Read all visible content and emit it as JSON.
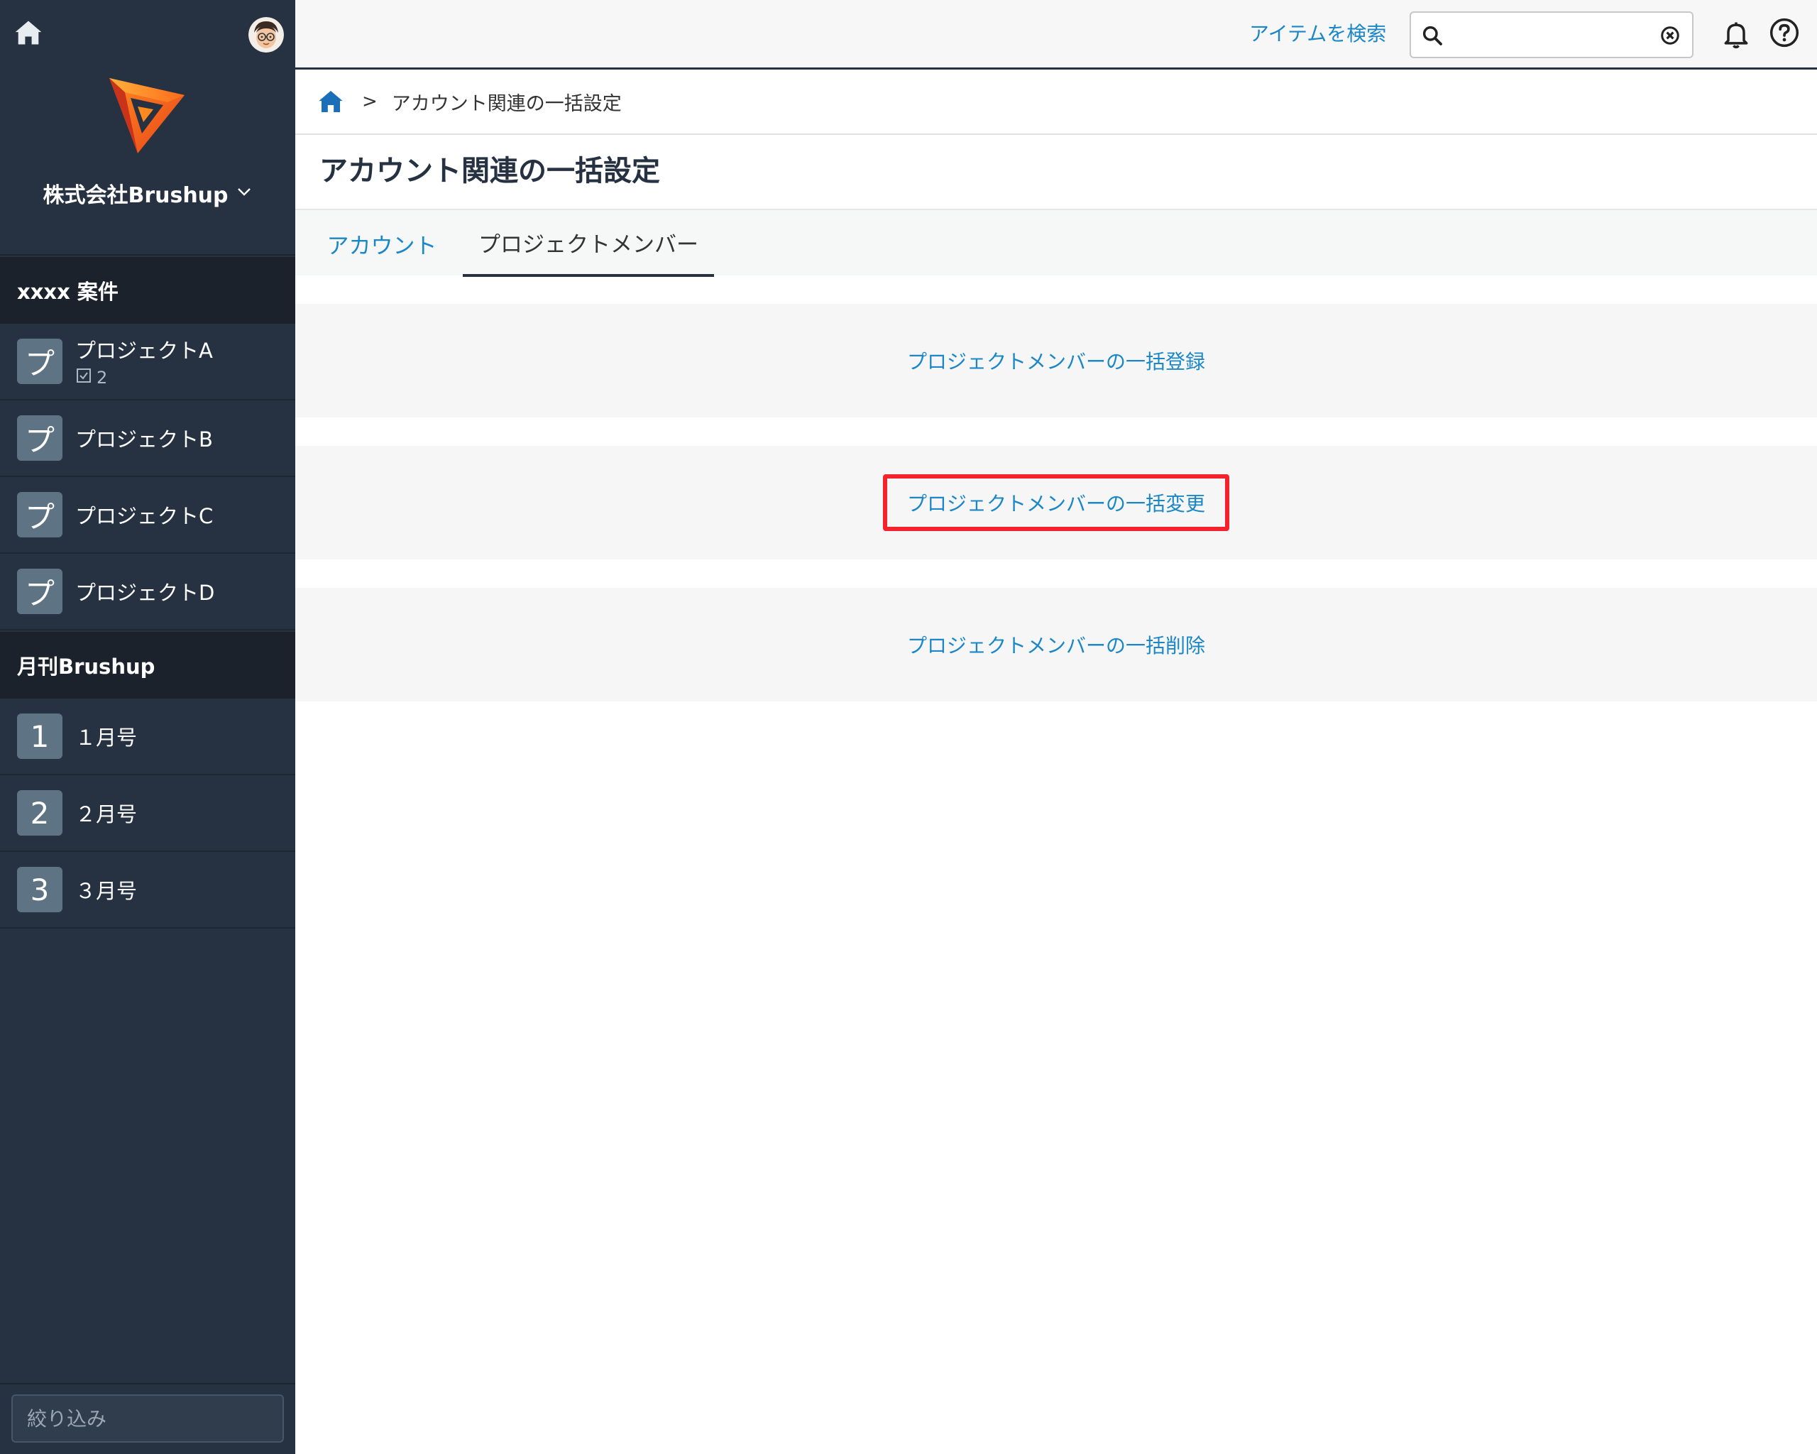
{
  "sidebar": {
    "org_name": "株式会社Brushup",
    "groups": [
      {
        "name": "xxxx 案件",
        "items": [
          {
            "badge": "プ",
            "label": "プロジェクトA",
            "count": "2"
          },
          {
            "badge": "プ",
            "label": "プロジェクトB"
          },
          {
            "badge": "プ",
            "label": "プロジェクトC"
          },
          {
            "badge": "プ",
            "label": "プロジェクトD"
          }
        ]
      },
      {
        "name": "月刊Brushup",
        "items": [
          {
            "badge": "1",
            "label": "１月号"
          },
          {
            "badge": "2",
            "label": "２月号"
          },
          {
            "badge": "3",
            "label": "３月号"
          }
        ]
      }
    ],
    "filter_placeholder": "絞り込み"
  },
  "topbar": {
    "search_link": "アイテムを検索",
    "search_value": ""
  },
  "breadcrumb": {
    "separator": ">",
    "current": "アカウント関連の一括設定"
  },
  "page": {
    "title": "アカウント関連の一括設定",
    "tabs": [
      {
        "label": "アカウント",
        "active": false
      },
      {
        "label": "プロジェクトメンバー",
        "active": true
      }
    ],
    "actions": [
      {
        "label": "プロジェクトメンバーの一括登録",
        "highlighted": false
      },
      {
        "label": "プロジェクトメンバーの一括変更",
        "highlighted": true
      },
      {
        "label": "プロジェクトメンバーの一括削除",
        "highlighted": false
      }
    ]
  },
  "colors": {
    "sidebar_bg": "#263241",
    "link": "#1b87c7",
    "highlight": "#f5222d",
    "badge_bg": "#5e7383"
  },
  "icons": [
    "home-icon",
    "user-avatar",
    "brushup-logo",
    "chevron-down-icon",
    "checklist-icon",
    "search-icon",
    "clear-icon",
    "bell-icon",
    "help-icon"
  ]
}
